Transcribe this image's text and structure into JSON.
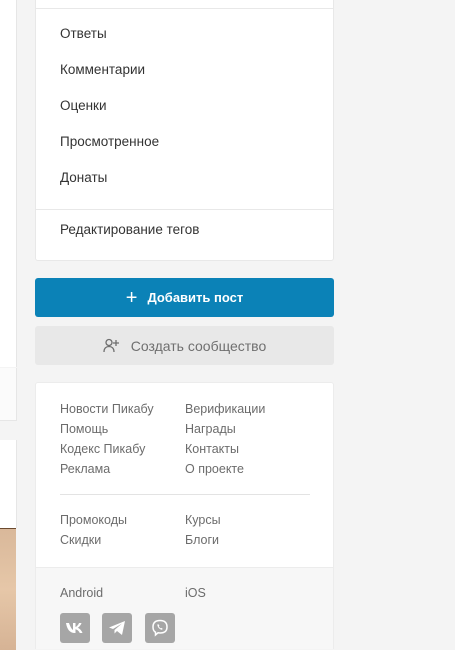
{
  "menu": {
    "items": [
      "Ответы",
      "Комментарии",
      "Оценки",
      "Просмотренное",
      "Донаты"
    ],
    "edit_tags": "Редактирование тегов"
  },
  "actions": {
    "add_post": "Добавить пост",
    "create_community": "Создать сообщество"
  },
  "footer": {
    "col1": [
      "Новости Пикабу",
      "Помощь",
      "Кодекс Пикабу",
      "Реклама"
    ],
    "col2": [
      "Верификации",
      "Награды",
      "Контакты",
      "О проекте"
    ],
    "col3": [
      "Промокоды",
      "Скидки"
    ],
    "col4": [
      "Курсы",
      "Блоги"
    ],
    "apps": [
      "Android",
      "iOS"
    ]
  },
  "social": [
    "vk-icon",
    "telegram-icon",
    "viber-icon"
  ],
  "colors": {
    "primary": "#0b82b7",
    "secondary_bg": "#e8e8e8",
    "icon_bg": "#a6a6a6"
  }
}
